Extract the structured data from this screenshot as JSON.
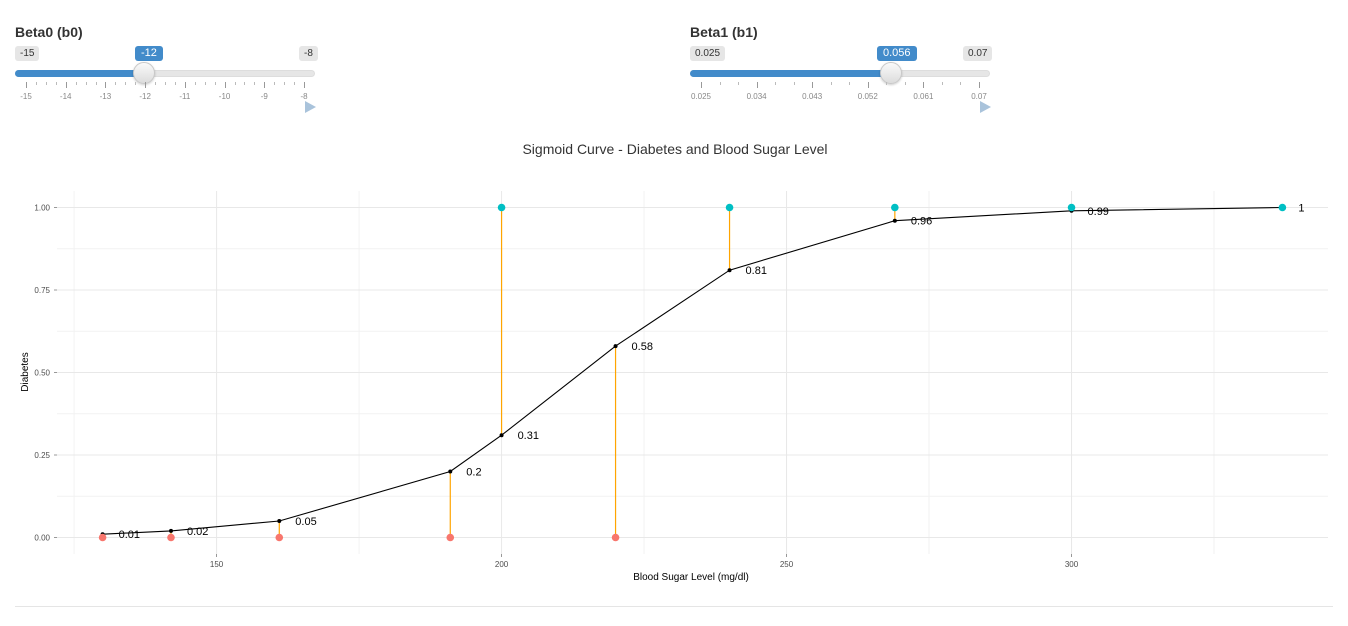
{
  "sliders": [
    {
      "label": "Beta0 (b0)",
      "min": -15,
      "max": -8,
      "value": -12,
      "min_label": "-15",
      "max_label": "-8",
      "value_label": "-12",
      "ticks": [
        "-15",
        "-14",
        "-13",
        "-12",
        "-11",
        "-10",
        "-9",
        "-8"
      ],
      "play_icon": "play-icon"
    },
    {
      "label": "Beta1 (b1)",
      "min": 0.025,
      "max": 0.07,
      "value": 0.056,
      "min_label": "0.025",
      "max_label": "0.07",
      "value_label": "0.056",
      "ticks": [
        "0.025",
        "0.034",
        "0.043",
        "0.052",
        "0.061",
        "0.07"
      ],
      "play_icon": "play-icon"
    }
  ],
  "colors": {
    "accent": "#428bca",
    "diabetes_positive": "#00BFC4",
    "diabetes_negative": "#F8766D",
    "residual": "#FFA500",
    "curve": "#000000"
  },
  "chart_data": {
    "type": "line",
    "title": "Sigmoid Curve - Diabetes and Blood Sugar Level",
    "xlabel": "Blood Sugar Level (mg/dl)",
    "ylabel": "Diabetes",
    "xlim": [
      122,
      345
    ],
    "ylim": [
      -0.05,
      1.05
    ],
    "x_ticks": [
      150,
      200,
      250,
      300
    ],
    "y_ticks": [
      "0.00",
      "0.25",
      "0.50",
      "0.75",
      "1.00"
    ],
    "y_tick_values": [
      0,
      0.25,
      0.5,
      0.75,
      1
    ],
    "grid": true,
    "observed": {
      "x": [
        130,
        142,
        161,
        191,
        200,
        220,
        240,
        269,
        300,
        337
      ],
      "y": [
        0,
        0,
        0,
        0,
        1,
        0,
        1,
        1,
        1,
        1
      ]
    },
    "predicted": {
      "x": [
        130,
        142,
        161,
        191,
        200,
        220,
        240,
        269,
        300,
        337
      ],
      "y": [
        0.01,
        0.02,
        0.05,
        0.2,
        0.31,
        0.58,
        0.81,
        0.96,
        0.99,
        1
      ],
      "labels": [
        "0.01",
        "0.02",
        "0.05",
        "0.2",
        "0.31",
        "0.58",
        "0.81",
        "0.96",
        "0.99",
        "1"
      ]
    }
  }
}
